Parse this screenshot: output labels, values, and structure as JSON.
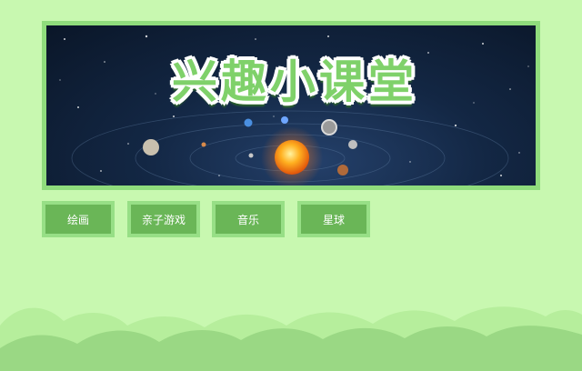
{
  "banner": {
    "title": "兴趣小课堂"
  },
  "nav": [
    {
      "label": "绘画"
    },
    {
      "label": "亲子游戏"
    },
    {
      "label": "音乐"
    },
    {
      "label": "星球"
    }
  ],
  "colors": {
    "background": "#c8f8b0",
    "button": "#6ab657",
    "button_border": "#97df86",
    "banner_frame": "#8fdc7c",
    "title_fill": "#7fd16a"
  }
}
